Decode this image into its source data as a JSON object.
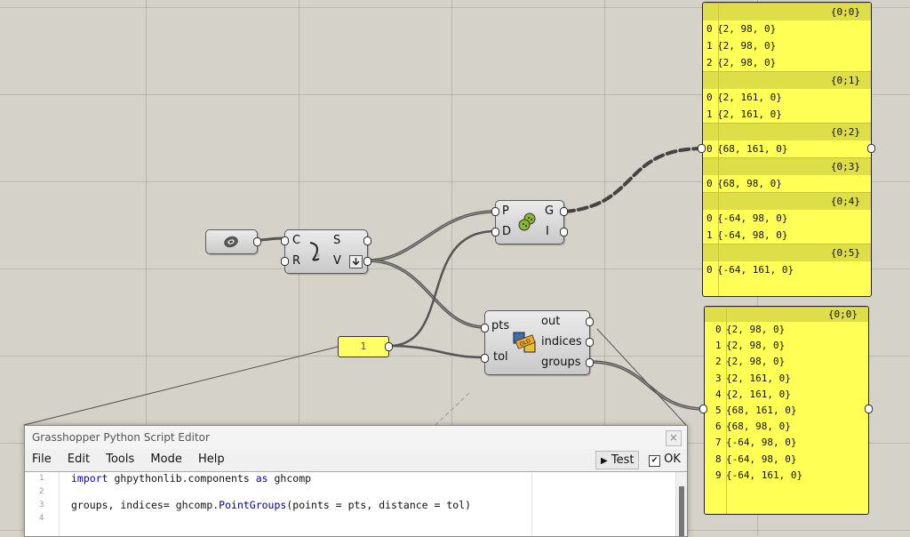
{
  "canvas": {
    "background": "#d5d2c9"
  },
  "nodes": {
    "circle": {
      "c_label": "C",
      "r_label": "R",
      "s_label": "S",
      "v_label": "V"
    },
    "pointgroups": {
      "p_label": "P",
      "d_label": "D",
      "g_label": "G",
      "i_label": "I"
    },
    "python": {
      "in1": "pts",
      "in2": "tol",
      "out1": "out",
      "out2": "indices",
      "out3": "groups"
    },
    "slider": {
      "value": "1"
    }
  },
  "panel_top": {
    "branches": [
      {
        "path": "{0;0}",
        "items": [
          {
            "i": "0",
            "v": "{2, 98, 0}"
          },
          {
            "i": "1",
            "v": "{2, 98, 0}"
          },
          {
            "i": "2",
            "v": "{2, 98, 0}"
          }
        ]
      },
      {
        "path": "{0;1}",
        "items": [
          {
            "i": "0",
            "v": "{2, 161, 0}"
          },
          {
            "i": "1",
            "v": "{2, 161, 0}"
          }
        ]
      },
      {
        "path": "{0;2}",
        "items": [
          {
            "i": "0",
            "v": "{68, 161, 0}"
          }
        ]
      },
      {
        "path": "{0;3}",
        "items": [
          {
            "i": "0",
            "v": "{68, 98, 0}"
          }
        ]
      },
      {
        "path": "{0;4}",
        "items": [
          {
            "i": "0",
            "v": "{-64, 98, 0}"
          },
          {
            "i": "1",
            "v": "{-64, 98, 0}"
          }
        ]
      },
      {
        "path": "{0;5}",
        "items": [
          {
            "i": "0",
            "v": "{-64, 161, 0}"
          }
        ]
      }
    ]
  },
  "panel_bottom": {
    "path": "{0;0}",
    "items": [
      {
        "i": "0",
        "v": "{2, 98, 0}"
      },
      {
        "i": "1",
        "v": "{2, 98, 0}"
      },
      {
        "i": "2",
        "v": "{2, 98, 0}"
      },
      {
        "i": "3",
        "v": "{2, 161, 0}"
      },
      {
        "i": "4",
        "v": "{2, 161, 0}"
      },
      {
        "i": "5",
        "v": "{68, 161, 0}"
      },
      {
        "i": "6",
        "v": "{68, 98, 0}"
      },
      {
        "i": "7",
        "v": "{-64, 98, 0}"
      },
      {
        "i": "8",
        "v": "{-64, 98, 0}"
      },
      {
        "i": "9",
        "v": "{-64, 161, 0}"
      }
    ]
  },
  "editor": {
    "title": "Grasshopper Python Script Editor",
    "menu": [
      "File",
      "Edit",
      "Tools",
      "Mode",
      "Help"
    ],
    "test_label": "Test",
    "ok_label": "OK",
    "close_glyph": "×",
    "line_numbers": [
      "1",
      "2",
      "3",
      "4"
    ],
    "code": {
      "l1_kw1": "import",
      "l1_mod": " ghpythonlib.components ",
      "l1_kw2": "as",
      "l1_alias": " ghcomp",
      "l3_pre": "groups, indices= ghcomp.",
      "l3_fn": "PointGroups",
      "l3_post": "(points = pts, distance = tol)"
    }
  }
}
